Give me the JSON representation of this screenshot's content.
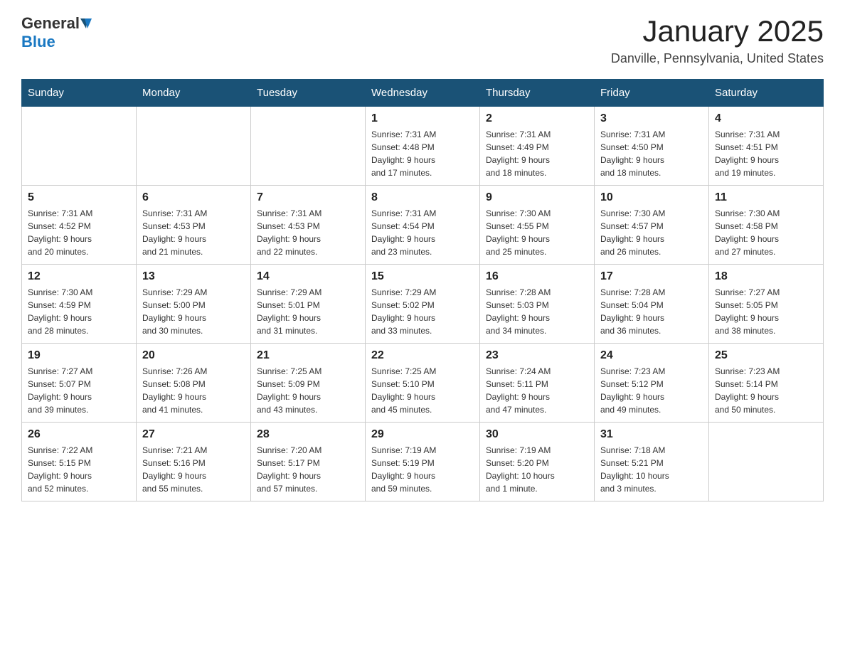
{
  "header": {
    "logo_general": "General",
    "logo_blue": "Blue",
    "month_title": "January 2025",
    "location": "Danville, Pennsylvania, United States"
  },
  "days_of_week": [
    "Sunday",
    "Monday",
    "Tuesday",
    "Wednesday",
    "Thursday",
    "Friday",
    "Saturday"
  ],
  "weeks": [
    [
      {
        "day": "",
        "info": ""
      },
      {
        "day": "",
        "info": ""
      },
      {
        "day": "",
        "info": ""
      },
      {
        "day": "1",
        "info": "Sunrise: 7:31 AM\nSunset: 4:48 PM\nDaylight: 9 hours\nand 17 minutes."
      },
      {
        "day": "2",
        "info": "Sunrise: 7:31 AM\nSunset: 4:49 PM\nDaylight: 9 hours\nand 18 minutes."
      },
      {
        "day": "3",
        "info": "Sunrise: 7:31 AM\nSunset: 4:50 PM\nDaylight: 9 hours\nand 18 minutes."
      },
      {
        "day": "4",
        "info": "Sunrise: 7:31 AM\nSunset: 4:51 PM\nDaylight: 9 hours\nand 19 minutes."
      }
    ],
    [
      {
        "day": "5",
        "info": "Sunrise: 7:31 AM\nSunset: 4:52 PM\nDaylight: 9 hours\nand 20 minutes."
      },
      {
        "day": "6",
        "info": "Sunrise: 7:31 AM\nSunset: 4:53 PM\nDaylight: 9 hours\nand 21 minutes."
      },
      {
        "day": "7",
        "info": "Sunrise: 7:31 AM\nSunset: 4:53 PM\nDaylight: 9 hours\nand 22 minutes."
      },
      {
        "day": "8",
        "info": "Sunrise: 7:31 AM\nSunset: 4:54 PM\nDaylight: 9 hours\nand 23 minutes."
      },
      {
        "day": "9",
        "info": "Sunrise: 7:30 AM\nSunset: 4:55 PM\nDaylight: 9 hours\nand 25 minutes."
      },
      {
        "day": "10",
        "info": "Sunrise: 7:30 AM\nSunset: 4:57 PM\nDaylight: 9 hours\nand 26 minutes."
      },
      {
        "day": "11",
        "info": "Sunrise: 7:30 AM\nSunset: 4:58 PM\nDaylight: 9 hours\nand 27 minutes."
      }
    ],
    [
      {
        "day": "12",
        "info": "Sunrise: 7:30 AM\nSunset: 4:59 PM\nDaylight: 9 hours\nand 28 minutes."
      },
      {
        "day": "13",
        "info": "Sunrise: 7:29 AM\nSunset: 5:00 PM\nDaylight: 9 hours\nand 30 minutes."
      },
      {
        "day": "14",
        "info": "Sunrise: 7:29 AM\nSunset: 5:01 PM\nDaylight: 9 hours\nand 31 minutes."
      },
      {
        "day": "15",
        "info": "Sunrise: 7:29 AM\nSunset: 5:02 PM\nDaylight: 9 hours\nand 33 minutes."
      },
      {
        "day": "16",
        "info": "Sunrise: 7:28 AM\nSunset: 5:03 PM\nDaylight: 9 hours\nand 34 minutes."
      },
      {
        "day": "17",
        "info": "Sunrise: 7:28 AM\nSunset: 5:04 PM\nDaylight: 9 hours\nand 36 minutes."
      },
      {
        "day": "18",
        "info": "Sunrise: 7:27 AM\nSunset: 5:05 PM\nDaylight: 9 hours\nand 38 minutes."
      }
    ],
    [
      {
        "day": "19",
        "info": "Sunrise: 7:27 AM\nSunset: 5:07 PM\nDaylight: 9 hours\nand 39 minutes."
      },
      {
        "day": "20",
        "info": "Sunrise: 7:26 AM\nSunset: 5:08 PM\nDaylight: 9 hours\nand 41 minutes."
      },
      {
        "day": "21",
        "info": "Sunrise: 7:25 AM\nSunset: 5:09 PM\nDaylight: 9 hours\nand 43 minutes."
      },
      {
        "day": "22",
        "info": "Sunrise: 7:25 AM\nSunset: 5:10 PM\nDaylight: 9 hours\nand 45 minutes."
      },
      {
        "day": "23",
        "info": "Sunrise: 7:24 AM\nSunset: 5:11 PM\nDaylight: 9 hours\nand 47 minutes."
      },
      {
        "day": "24",
        "info": "Sunrise: 7:23 AM\nSunset: 5:12 PM\nDaylight: 9 hours\nand 49 minutes."
      },
      {
        "day": "25",
        "info": "Sunrise: 7:23 AM\nSunset: 5:14 PM\nDaylight: 9 hours\nand 50 minutes."
      }
    ],
    [
      {
        "day": "26",
        "info": "Sunrise: 7:22 AM\nSunset: 5:15 PM\nDaylight: 9 hours\nand 52 minutes."
      },
      {
        "day": "27",
        "info": "Sunrise: 7:21 AM\nSunset: 5:16 PM\nDaylight: 9 hours\nand 55 minutes."
      },
      {
        "day": "28",
        "info": "Sunrise: 7:20 AM\nSunset: 5:17 PM\nDaylight: 9 hours\nand 57 minutes."
      },
      {
        "day": "29",
        "info": "Sunrise: 7:19 AM\nSunset: 5:19 PM\nDaylight: 9 hours\nand 59 minutes."
      },
      {
        "day": "30",
        "info": "Sunrise: 7:19 AM\nSunset: 5:20 PM\nDaylight: 10 hours\nand 1 minute."
      },
      {
        "day": "31",
        "info": "Sunrise: 7:18 AM\nSunset: 5:21 PM\nDaylight: 10 hours\nand 3 minutes."
      },
      {
        "day": "",
        "info": ""
      }
    ]
  ]
}
